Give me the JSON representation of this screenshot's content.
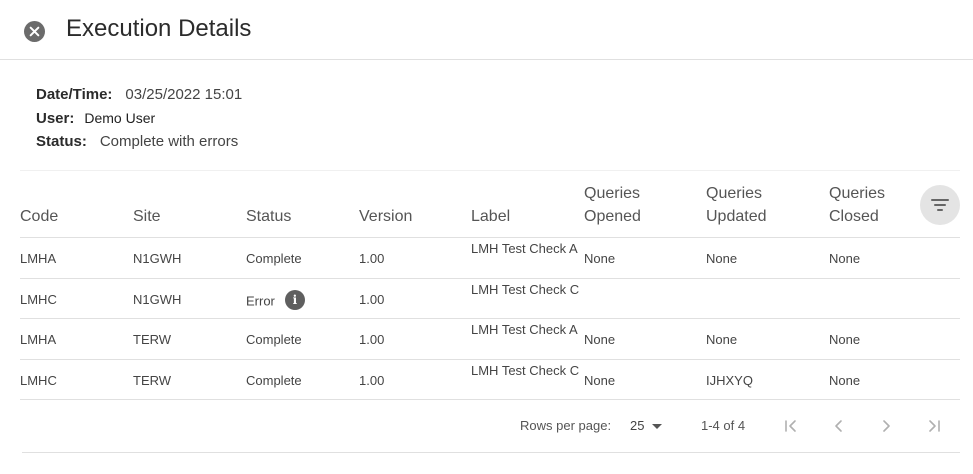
{
  "header": {
    "title": "Execution Details",
    "close_icon": "close-circle-icon"
  },
  "meta": {
    "date_label": "Date/Time:",
    "date_value": "03/25/2022 15:01",
    "user_label": "User:",
    "user_value": "Demo User",
    "status_label": "Status:",
    "status_value": "Complete with errors"
  },
  "table": {
    "columns": [
      [
        "Code"
      ],
      [
        "Site"
      ],
      [
        "Status"
      ],
      [
        "Version"
      ],
      [
        "Label"
      ],
      [
        "Queries",
        "Opened"
      ],
      [
        "Queries",
        "Updated"
      ],
      [
        "Queries",
        "Closed"
      ]
    ],
    "filter_icon": "filter-list-icon",
    "rows": [
      {
        "code": "LMHA",
        "site": "N1GWH",
        "status": "Complete",
        "version": "1.00",
        "label": "LMH Test Check A",
        "opened": "None",
        "updated": "None",
        "closed": "None",
        "info": false
      },
      {
        "code": "LMHC",
        "site": "N1GWH",
        "status": "Error",
        "version": "1.00",
        "label": "LMH Test Check C",
        "opened": "",
        "updated": "",
        "closed": "",
        "info": true
      },
      {
        "code": "LMHA",
        "site": "TERW",
        "status": "Complete",
        "version": "1.00",
        "label": "LMH Test Check A",
        "opened": "None",
        "updated": "None",
        "closed": "None",
        "info": false
      },
      {
        "code": "LMHC",
        "site": "TERW",
        "status": "Complete",
        "version": "1.00",
        "label": "LMH Test Check C",
        "opened": "None",
        "updated": "IJHXYQ",
        "closed": "None",
        "info": false
      }
    ]
  },
  "pagination": {
    "rows_per_page_label": "Rows per page:",
    "rows_per_page_value": "25",
    "range": "1-4 of 4"
  },
  "colors": {
    "icon_dark": "#6b6b6b",
    "filter_bg": "#e4e4e4",
    "divider": "#e0e0e0",
    "disabled": "#b0b0b0"
  }
}
